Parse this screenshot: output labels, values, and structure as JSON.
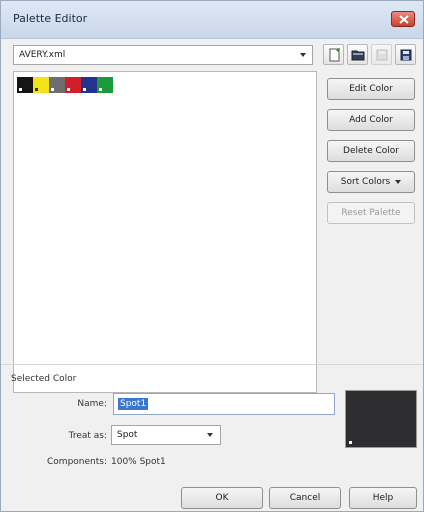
{
  "window": {
    "title": "Palette Editor"
  },
  "palette_file": {
    "value": "AVERY.xml"
  },
  "toolbar": {
    "icons": [
      "new-palette-icon",
      "open-palette-icon",
      "save-palette-disabled-icon",
      "save-as-palette-icon"
    ]
  },
  "swatches": [
    {
      "color": "#151515",
      "light": false
    },
    {
      "color": "#f4e21a",
      "light": true
    },
    {
      "color": "#6e6e6e",
      "light": false
    },
    {
      "color": "#d11f2a",
      "light": false
    },
    {
      "color": "#23348f",
      "light": false
    },
    {
      "color": "#1b9a3a",
      "light": false
    }
  ],
  "buttons": {
    "edit_color": "Edit Color",
    "add_color": "Add Color",
    "delete_color": "Delete Color",
    "sort_colors": "Sort Colors",
    "reset_palette": "Reset Palette"
  },
  "selected": {
    "group_label": "Selected Color",
    "name_label": "Name:",
    "name_value": "Spot1",
    "treat_label": "Treat as:",
    "treat_value": "Spot",
    "components_label": "Components:",
    "components_value": "100% Spot1",
    "preview_color": "#2e2e30"
  },
  "footer": {
    "ok": "OK",
    "cancel": "Cancel",
    "help": "Help"
  }
}
